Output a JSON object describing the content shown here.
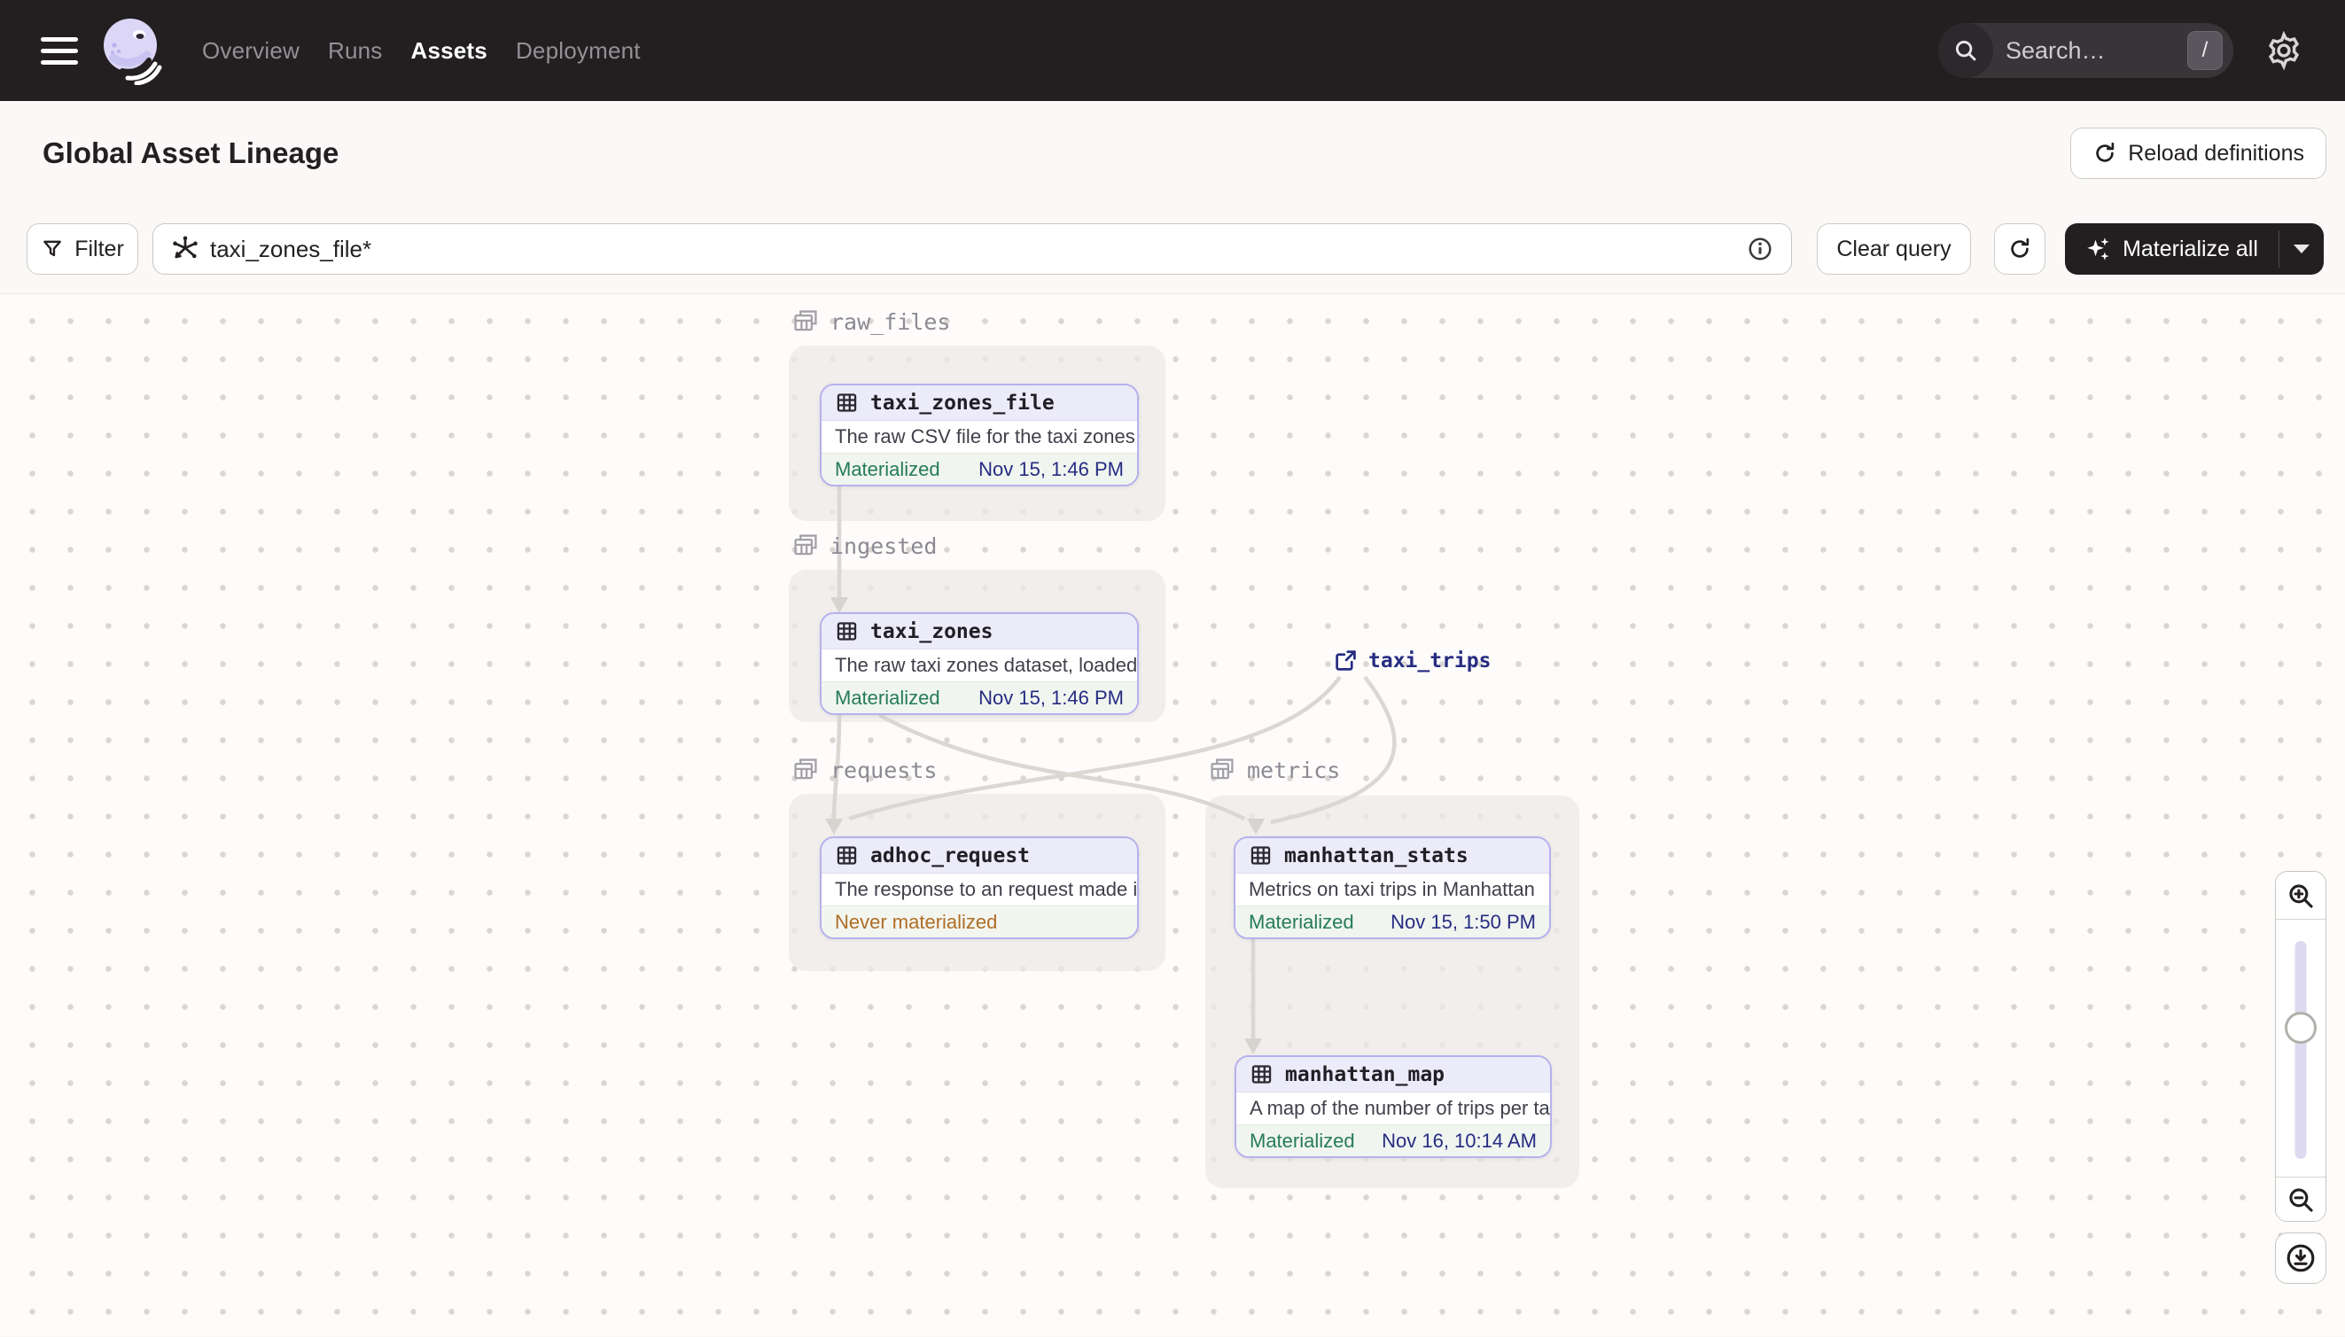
{
  "nav": {
    "links": [
      {
        "label": "Overview",
        "active": false
      },
      {
        "label": "Runs",
        "active": false
      },
      {
        "label": "Assets",
        "active": true
      },
      {
        "label": "Deployment",
        "active": false
      }
    ],
    "search_placeholder": "Search…",
    "search_shortcut": "/"
  },
  "header": {
    "title": "Global Asset Lineage",
    "reload_button": "Reload definitions"
  },
  "toolbar": {
    "filter_label": "Filter",
    "query_value": "taxi_zones_file*",
    "clear_button": "Clear query",
    "materialize_button": "Materialize all"
  },
  "graph": {
    "groups": [
      {
        "name": "raw_files"
      },
      {
        "name": "ingested"
      },
      {
        "name": "requests"
      },
      {
        "name": "metrics"
      }
    ],
    "nodes": [
      {
        "name": "taxi_zones_file",
        "group": "raw_files",
        "description": "The raw CSV file for the taxi zones dat…",
        "status": "Materialized",
        "timestamp": "Nov 15, 1:46 PM"
      },
      {
        "name": "taxi_zones",
        "group": "ingested",
        "description": "The raw taxi zones dataset, loaded int…",
        "status": "Materialized",
        "timestamp": "Nov 15, 1:46 PM"
      },
      {
        "name": "adhoc_request",
        "group": "requests",
        "description": "The response to an request made in th…",
        "status": "Never materialized",
        "timestamp": ""
      },
      {
        "name": "manhattan_stats",
        "group": "metrics",
        "description": "Metrics on taxi trips in Manhattan",
        "status": "Materialized",
        "timestamp": "Nov 15, 1:50 PM"
      },
      {
        "name": "manhattan_map",
        "group": "metrics",
        "description": "A map of the number of trips per taxi z…",
        "status": "Materialized",
        "timestamp": "Nov 16, 10:14 AM"
      }
    ],
    "external_asset": {
      "name": "taxi_trips"
    },
    "edges": [
      [
        "taxi_zones_file",
        "taxi_zones"
      ],
      [
        "taxi_zones",
        "adhoc_request"
      ],
      [
        "taxi_zones",
        "manhattan_stats"
      ],
      [
        "taxi_trips",
        "adhoc_request"
      ],
      [
        "taxi_trips",
        "manhattan_stats"
      ],
      [
        "manhattan_stats",
        "manhattan_map"
      ]
    ]
  },
  "icons": {
    "menu": "hamburger-icon",
    "search": "magnifier-icon",
    "shortcut": "slash-key",
    "settings": "gear-icon",
    "reload": "refresh-icon",
    "filter": "funnel-icon",
    "query": "lineage-selector-icon",
    "info": "info-icon",
    "materialize": "sparkles-icon",
    "group": "layered-table-icon",
    "asset": "table-icon",
    "external": "external-link-icon",
    "zoom_in": "zoom-in-icon",
    "zoom_out": "zoom-out-icon",
    "download": "download-icon"
  },
  "colors": {
    "navbar_bg": "#231F21",
    "page_bg": "#FAF9F7",
    "canvas_bg": "#FDFCFB",
    "node_border": "#B6B1EC",
    "node_header_bg": "#ECEBF9",
    "status_materialized": "#267C56",
    "status_never_materialized": "#AE6E26",
    "timestamp_text": "#262C81",
    "edge": "#DBD7D3"
  }
}
